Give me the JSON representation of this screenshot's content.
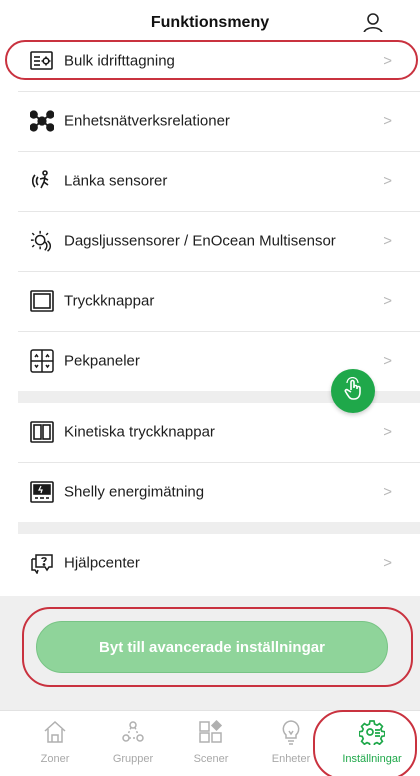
{
  "header": {
    "title": "Funktionsmeny",
    "user_icon": "person-icon"
  },
  "menu": {
    "chevron": ">",
    "items": [
      {
        "label": "Bulk idrifttagning",
        "icon": "bulk-commission-icon"
      },
      {
        "label": "Enhetsnätverksrelationer",
        "icon": "network-icon"
      },
      {
        "label": "Länka sensorer",
        "icon": "link-sensor-icon"
      },
      {
        "label": "Dagsljussensorer / EnOcean Multisensor",
        "icon": "daylight-sensor-icon"
      },
      {
        "label": "Tryckknappar",
        "icon": "push-button-icon"
      },
      {
        "label": "Pekpaneler",
        "icon": "touch-panel-icon"
      },
      {
        "label": "Kinetiska tryckknappar",
        "icon": "kinetic-button-icon"
      },
      {
        "label": "Shelly energimätning",
        "icon": "energy-meter-icon"
      },
      {
        "label": "Hjälpcenter",
        "icon": "help-chat-icon"
      }
    ]
  },
  "advanced_button": {
    "label": "Byt till avancerade inställningar"
  },
  "fab": {
    "icon": "tap-hand-icon"
  },
  "tabs": [
    {
      "label": "Zoner",
      "icon": "home-icon",
      "active": false
    },
    {
      "label": "Grupper",
      "icon": "groups-icon",
      "active": false
    },
    {
      "label": "Scener",
      "icon": "scenes-icon",
      "active": false
    },
    {
      "label": "Enheter",
      "icon": "bulb-icon",
      "active": false
    },
    {
      "label": "Inställningar",
      "icon": "settings-icon",
      "active": true
    }
  ],
  "colors": {
    "accent": "#1fa84a",
    "highlight": "#c9323f",
    "button": "#8fd49a"
  }
}
